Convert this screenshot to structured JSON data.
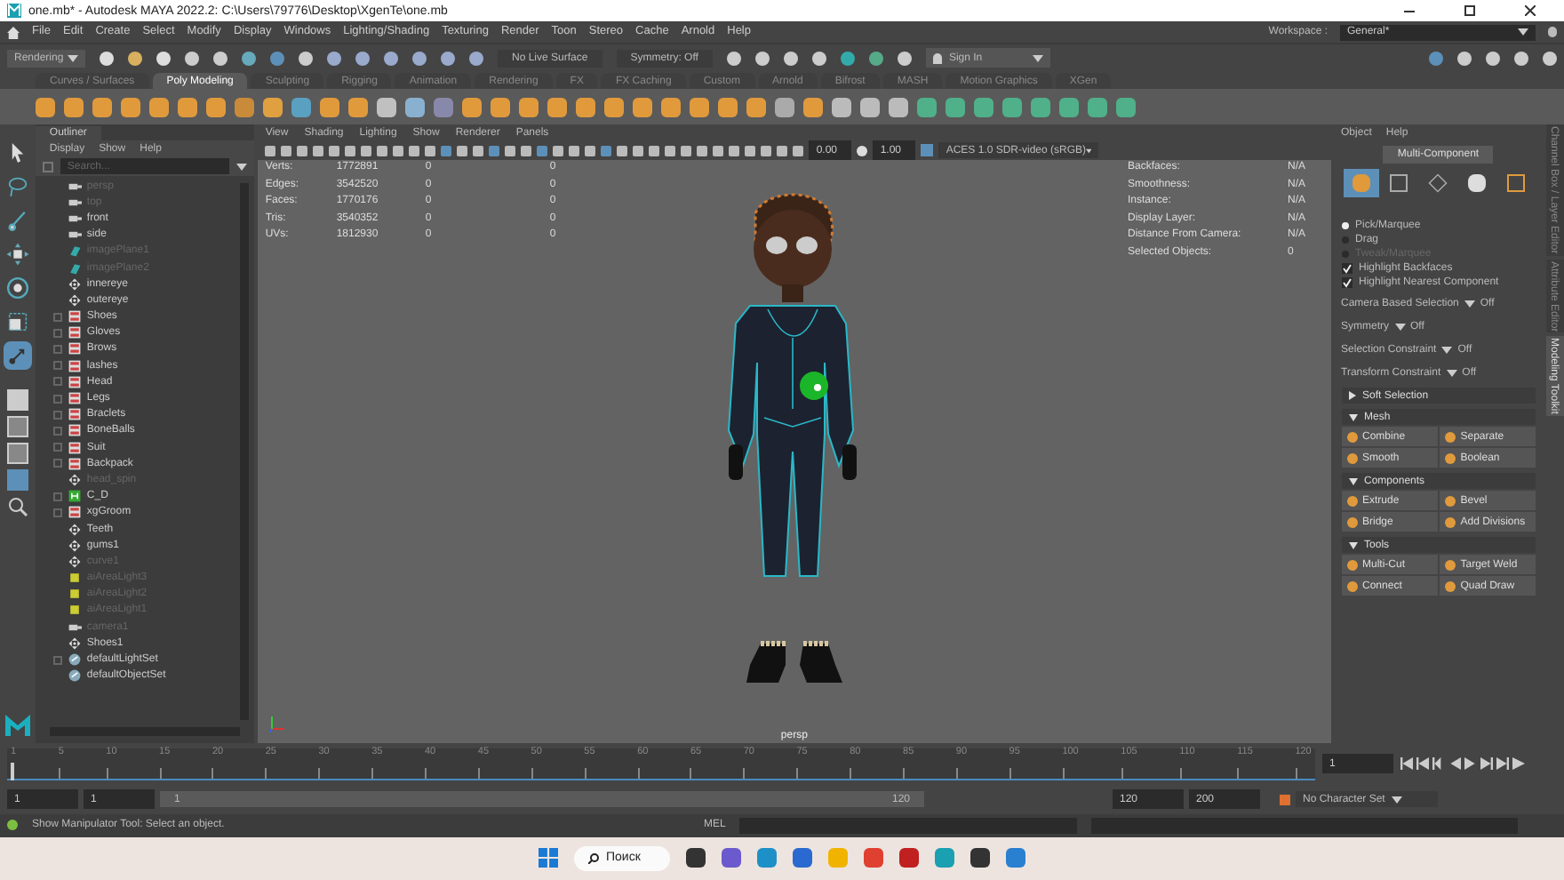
{
  "window": {
    "title": "one.mb* - Autodesk MAYA 2022.2: C:\\Users\\79776\\Desktop\\XgenTe\\one.mb"
  },
  "menu": [
    "File",
    "Edit",
    "Create",
    "Select",
    "Modify",
    "Display",
    "Windows",
    "Lighting/Shading",
    "Texturing",
    "Render",
    "Toon",
    "Stereo",
    "Cache",
    "Arnold",
    "Help"
  ],
  "workspace": {
    "label": "Workspace :",
    "value": "General*"
  },
  "status_line": {
    "menu_set": "Rendering",
    "live_surface": "No Live Surface",
    "symmetry": "Symmetry: Off",
    "sign_in": "Sign In"
  },
  "shelf_tabs": [
    {
      "label": "Curves / Surfaces",
      "selected": false
    },
    {
      "label": "Poly Modeling",
      "selected": true
    },
    {
      "label": "Sculpting",
      "selected": false
    },
    {
      "label": "Rigging",
      "selected": false
    },
    {
      "label": "Animation",
      "selected": false
    },
    {
      "label": "Rendering",
      "selected": false
    },
    {
      "label": "FX",
      "selected": false
    },
    {
      "label": "FX Caching",
      "selected": false
    },
    {
      "label": "Custom",
      "selected": false
    },
    {
      "label": "Arnold",
      "selected": false
    },
    {
      "label": "Bifrost",
      "selected": false
    },
    {
      "label": "MASH",
      "selected": false
    },
    {
      "label": "Motion Graphics",
      "selected": false
    },
    {
      "label": "XGen",
      "selected": false
    }
  ],
  "tools": [
    {
      "kind": "select",
      "selected": false
    },
    {
      "kind": "lasso",
      "selected": false
    },
    {
      "kind": "paint",
      "selected": false
    },
    {
      "kind": "move",
      "selected": false
    },
    {
      "kind": "rotate",
      "selected": false
    },
    {
      "kind": "scale",
      "selected": false
    },
    {
      "kind": "last",
      "selected": true
    }
  ],
  "outliner": {
    "title": "Outliner",
    "menu": [
      "Display",
      "Show",
      "Help"
    ],
    "search": {
      "placeholder": "Search..."
    },
    "items": [
      {
        "name": "persp",
        "kind": "camera",
        "hidden": true,
        "expandable": false
      },
      {
        "name": "top",
        "kind": "camera",
        "hidden": true,
        "expandable": false
      },
      {
        "name": "front",
        "kind": "camera",
        "hidden": false,
        "expandable": false
      },
      {
        "name": "side",
        "kind": "camera",
        "hidden": false,
        "expandable": false
      },
      {
        "name": "imagePlane1",
        "kind": "plane",
        "hidden": true,
        "expandable": false
      },
      {
        "name": "imagePlane2",
        "kind": "plane",
        "hidden": true,
        "expandable": false
      },
      {
        "name": "innereye",
        "kind": "transform",
        "hidden": false,
        "expandable": false
      },
      {
        "name": "outereye",
        "kind": "transform",
        "hidden": false,
        "expandable": false
      },
      {
        "name": "Shoes",
        "kind": "mesh",
        "hidden": false,
        "expandable": true
      },
      {
        "name": "Gloves",
        "kind": "mesh",
        "hidden": false,
        "expandable": true
      },
      {
        "name": "Brows",
        "kind": "mesh",
        "hidden": false,
        "expandable": true
      },
      {
        "name": "lashes",
        "kind": "mesh",
        "hidden": false,
        "expandable": true
      },
      {
        "name": "Head",
        "kind": "mesh",
        "hidden": false,
        "expandable": true
      },
      {
        "name": "Legs",
        "kind": "mesh",
        "hidden": false,
        "expandable": true
      },
      {
        "name": "Braclets",
        "kind": "mesh",
        "hidden": false,
        "expandable": true
      },
      {
        "name": "BoneBalls",
        "kind": "mesh",
        "hidden": false,
        "expandable": true
      },
      {
        "name": "Suit",
        "kind": "mesh",
        "hidden": false,
        "expandable": true
      },
      {
        "name": "Backpack",
        "kind": "mesh",
        "hidden": false,
        "expandable": true
      },
      {
        "name": "head_spin",
        "kind": "transform",
        "hidden": true,
        "expandable": false
      },
      {
        "name": "C_D",
        "kind": "group",
        "hidden": false,
        "expandable": true
      },
      {
        "name": "xgGroom",
        "kind": "mesh",
        "hidden": false,
        "expandable": true
      },
      {
        "name": "Teeth",
        "kind": "transform",
        "hidden": false,
        "expandable": false
      },
      {
        "name": "gums1",
        "kind": "transform",
        "hidden": false,
        "expandable": false
      },
      {
        "name": "curve1",
        "kind": "transform",
        "hidden": true,
        "expandable": false
      },
      {
        "name": "aiAreaLight3",
        "kind": "light",
        "hidden": true,
        "expandable": false
      },
      {
        "name": "aiAreaLight2",
        "kind": "light",
        "hidden": true,
        "expandable": false
      },
      {
        "name": "aiAreaLight1",
        "kind": "light",
        "hidden": true,
        "expandable": false
      },
      {
        "name": "camera1",
        "kind": "camera",
        "hidden": true,
        "expandable": false
      },
      {
        "name": "Shoes1",
        "kind": "transform",
        "hidden": false,
        "expandable": false
      },
      {
        "name": "defaultLightSet",
        "kind": "set",
        "hidden": false,
        "expandable": true
      },
      {
        "name": "defaultObjectSet",
        "kind": "set",
        "hidden": false,
        "expandable": false
      }
    ]
  },
  "viewport": {
    "menu": [
      "View",
      "Shading",
      "Lighting",
      "Show",
      "Renderer",
      "Panels"
    ],
    "exposure": "0.00",
    "gamma": "1.00",
    "color_space": "ACES 1.0 SDR-video (sRGB)",
    "camera": "persp",
    "stats": [
      {
        "label": "Verts:",
        "values": [
          "1772891",
          "0",
          "0"
        ]
      },
      {
        "label": "Edges:",
        "values": [
          "3542520",
          "0",
          "0"
        ]
      },
      {
        "label": "Faces:",
        "values": [
          "1770176",
          "0",
          "0"
        ]
      },
      {
        "label": "Tris:",
        "values": [
          "3540352",
          "0",
          "0"
        ]
      },
      {
        "label": "UVs:",
        "values": [
          "1812930",
          "0",
          "0"
        ]
      }
    ],
    "info": [
      {
        "label": "Backfaces:",
        "value": "N/A"
      },
      {
        "label": "Smoothness:",
        "value": "N/A"
      },
      {
        "label": "Instance:",
        "value": "N/A"
      },
      {
        "label": "Display Layer:",
        "value": "N/A"
      },
      {
        "label": "Distance From Camera:",
        "value": "N/A"
      },
      {
        "label": "Selected Objects:",
        "value": "0"
      }
    ]
  },
  "toolkit": {
    "menu": [
      "Object",
      "Help"
    ],
    "mode": "Multi-Component",
    "component_modes": [
      {
        "kind": "object",
        "selected": true
      },
      {
        "kind": "face",
        "selected": false
      },
      {
        "kind": "vertex",
        "selected": false
      },
      {
        "kind": "uv",
        "selected": false
      },
      {
        "kind": "multi",
        "selected": false
      }
    ],
    "pick": [
      {
        "label": "Pick/Marquee",
        "selected": true,
        "disabled": false
      },
      {
        "label": "Drag",
        "selected": false,
        "disabled": false
      },
      {
        "label": "Tweak/Marquee",
        "selected": false,
        "disabled": true
      }
    ],
    "checks": [
      {
        "label": "Highlight Backfaces",
        "checked": true
      },
      {
        "label": "Highlight Nearest Component",
        "checked": true
      }
    ],
    "options": [
      {
        "label": "Camera Based Selection",
        "value": "Off"
      },
      {
        "label": "Symmetry",
        "value": "Off"
      },
      {
        "label": "Selection Constraint",
        "value": "Off"
      },
      {
        "label": "Transform Constraint",
        "value": "Off"
      }
    ],
    "soft_selection": {
      "label": "Soft Selection",
      "expanded": false
    },
    "sections": [
      {
        "title": "Mesh",
        "expanded": true,
        "buttons": [
          "Combine",
          "Separate",
          "Smooth",
          "Boolean"
        ]
      },
      {
        "title": "Components",
        "expanded": true,
        "buttons": [
          "Extrude",
          "Bevel",
          "Bridge",
          "Add Divisions"
        ]
      },
      {
        "title": "Tools",
        "expanded": true,
        "buttons": [
          "Multi-Cut",
          "Target Weld",
          "Connect",
          "Quad Draw"
        ]
      }
    ]
  },
  "side_tabs": [
    {
      "label": "Channel Box / Layer Editor",
      "selected": false
    },
    {
      "label": "Attribute Editor",
      "selected": false
    },
    {
      "label": "Modeling Toolkit",
      "selected": true
    }
  ],
  "timeline": {
    "ticks": [
      "1",
      "5",
      "10",
      "15",
      "20",
      "25",
      "30",
      "35",
      "40",
      "45",
      "50",
      "55",
      "60",
      "65",
      "70",
      "75",
      "80",
      "85",
      "90",
      "95",
      "100",
      "105",
      "110",
      "115",
      "120"
    ],
    "current_frame": "1",
    "level": 0
  },
  "range": {
    "start": "1",
    "playback_start": "1",
    "slider_start": "1",
    "slider_end": "120",
    "playback_end": "120",
    "end": "200",
    "level": 1,
    "character_set": "No Character Set"
  },
  "command": {
    "help": "Show Manipulator Tool: Select an object.",
    "language": "MEL"
  },
  "taskbar": {
    "search": "Поиск"
  }
}
